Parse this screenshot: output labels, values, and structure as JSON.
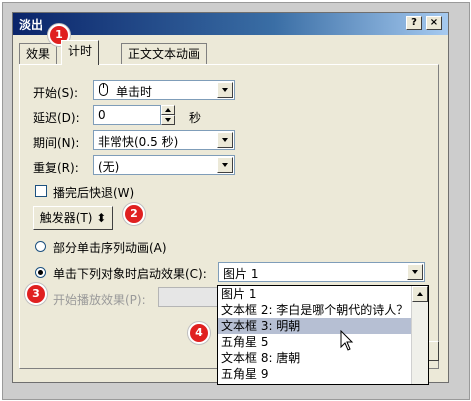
{
  "window": {
    "title": "淡出",
    "help_label": "?",
    "close_label": "×"
  },
  "tabs": [
    {
      "label": "效果",
      "active": false
    },
    {
      "label": "计时",
      "active": true
    },
    {
      "label": "正文文本动画",
      "active": false
    }
  ],
  "timing": {
    "start_label": "开始(S):",
    "start_value": "单击时",
    "delay_label": "延迟(D):",
    "delay_value": "0",
    "delay_unit": "秒",
    "duration_label": "期间(N):",
    "duration_value": "非常快(0.5 秒)",
    "repeat_label": "重复(R):",
    "repeat_value": "(无)",
    "rewind_label": "播完后快退(W)",
    "rewind_checked": false,
    "trigger_button": "触发器(T)",
    "trigger_arrow": "⬍",
    "option_sequence_label": "部分单击序列动画(A)",
    "option_object_label": "单击下列对象时启动效果(C):",
    "object_value": "图片 1",
    "play_effect_label": "开始播放效果(P):"
  },
  "dropdown_items": [
    {
      "label": "图片 1",
      "selected": false
    },
    {
      "label": "文本框 2: 李白是哪个朝代的诗人？",
      "selected": false
    },
    {
      "label": "文本框 3: 明朝",
      "selected": true
    },
    {
      "label": "五角星 5",
      "selected": false
    },
    {
      "label": "文本框 8: 唐朝",
      "selected": false
    },
    {
      "label": "五角星 9",
      "selected": false
    }
  ],
  "annotations": [
    "1",
    "2",
    "3",
    "4"
  ],
  "colors": {
    "badge": "#e02020",
    "dialog_bg": "#ece9d8",
    "selection": "#b6bfd3"
  }
}
